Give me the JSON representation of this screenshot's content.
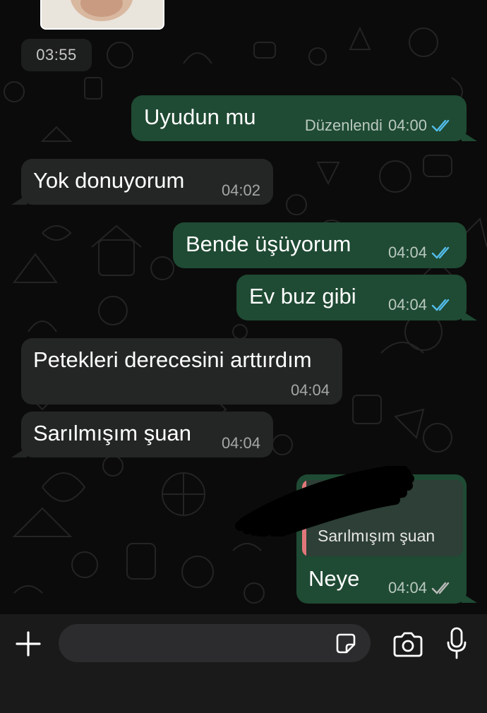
{
  "header_time": "03:55",
  "messages": [
    {
      "dir": "out",
      "text": "Uyudun mu",
      "edited": "Düzenlendi",
      "time": "04:00",
      "status": "read"
    },
    {
      "dir": "in",
      "text": "Yok donuyorum",
      "time": "04:02"
    },
    {
      "dir": "out",
      "text": "Bende üşüyorum",
      "time": "04:04",
      "status": "read"
    },
    {
      "dir": "out",
      "text": "Ev buz gibi",
      "time": "04:04",
      "status": "read"
    },
    {
      "dir": "in",
      "text": "Petekleri derecesini arttırdım",
      "time": "04:04"
    },
    {
      "dir": "in",
      "text": "Sarılmışım şuan",
      "time": "04:04"
    },
    {
      "dir": "out",
      "text": "Neye",
      "time": "04:04",
      "status": "delivered",
      "reply_to": "Sarılmışım şuan"
    }
  ],
  "composer": {
    "placeholder": ""
  },
  "icons": {
    "plus": "plus-icon",
    "sticker": "sticker-icon",
    "camera": "camera-icon",
    "mic": "microphone-icon",
    "read_ticks": "double-check-blue-icon",
    "delivered_ticks": "double-check-grey-icon"
  },
  "colors": {
    "outgoing_bubble": "#1f4a33",
    "incoming_bubble": "#242626",
    "read_tick": "#53bdeb",
    "delivered_tick": "#bcbcbc",
    "reply_bar": "#e1777a"
  }
}
